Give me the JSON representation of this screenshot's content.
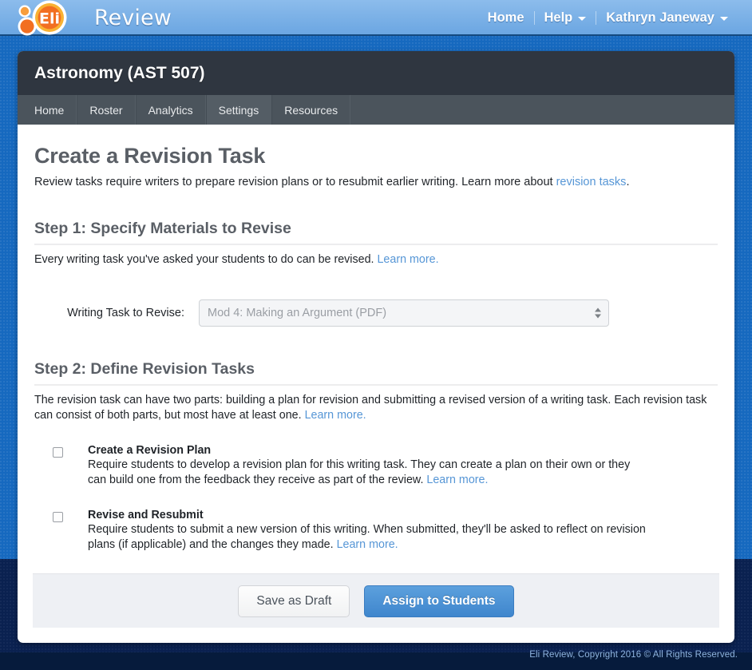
{
  "brand": {
    "logo_icon": "eli-review-logo-icon",
    "name": "Review"
  },
  "topnav": {
    "items": [
      {
        "label": "Home",
        "icon": null
      },
      {
        "label": "Help",
        "icon": "chevron-down-icon"
      },
      {
        "label": "Kathryn Janeway",
        "icon": "chevron-down-icon"
      }
    ]
  },
  "course": {
    "title": "Astronomy (AST 507)",
    "tabs": [
      {
        "label": "Home",
        "active": false
      },
      {
        "label": "Roster",
        "active": false
      },
      {
        "label": "Analytics",
        "active": false
      },
      {
        "label": "Settings",
        "active": true
      },
      {
        "label": "Resources",
        "active": false
      }
    ]
  },
  "page": {
    "title": "Create a Revision Task",
    "lead_text": "Review tasks require writers to prepare revision plans or to resubmit earlier writing. Learn more about ",
    "lead_link": "revision tasks",
    "lead_tail": "."
  },
  "step1": {
    "heading": "Step 1: Specify Materials to Revise",
    "sub_text": "Every writing task you've asked your students to do can be revised. ",
    "sub_link": "Learn more.",
    "select_label": "Writing Task to Revise:",
    "select_value": "Mod 4: Making an Argument (PDF)",
    "select_placeholder": "Mod 4: Making an Argument (PDF)",
    "stepper_icon": "up-down-stepper-icon"
  },
  "step2": {
    "heading": "Step 2: Define Revision Tasks",
    "sub_text": "The revision task can have two parts: building a plan for revision and submitting a revised version of a writing task. Each revision task can consist of both parts, but most have at least one. ",
    "sub_link": "Learn more.",
    "options": [
      {
        "title": "Create a Revision Plan",
        "desc": "Require students to develop a revision plan for this writing task. They can create a plan on their own or they can build one from the feedback they receive as part of the review. ",
        "link": "Learn more.",
        "checked": false
      },
      {
        "title": "Revise and Resubmit",
        "desc": "Require students to submit a new version of this writing. When submitted, they'll be asked to reflect on revision plans (if applicable) and the changes they made. ",
        "link": "Learn more.",
        "checked": false
      }
    ]
  },
  "actions": {
    "draft_label": "Save as Draft",
    "assign_label": "Assign to Students"
  },
  "footer": {
    "copyright": "Eli Review, Copyright 2016 © All Rights Reserved."
  },
  "colors": {
    "topbar_blue": "#7ab0e6",
    "page_blue": "#1669bf",
    "footer_navy": "#0a2150",
    "course_header": "#2f3640",
    "tabbar": "#4b545c",
    "link_blue": "#5696d6",
    "primary_button": "#4a90d9",
    "logo_orange": "#f47b20"
  }
}
